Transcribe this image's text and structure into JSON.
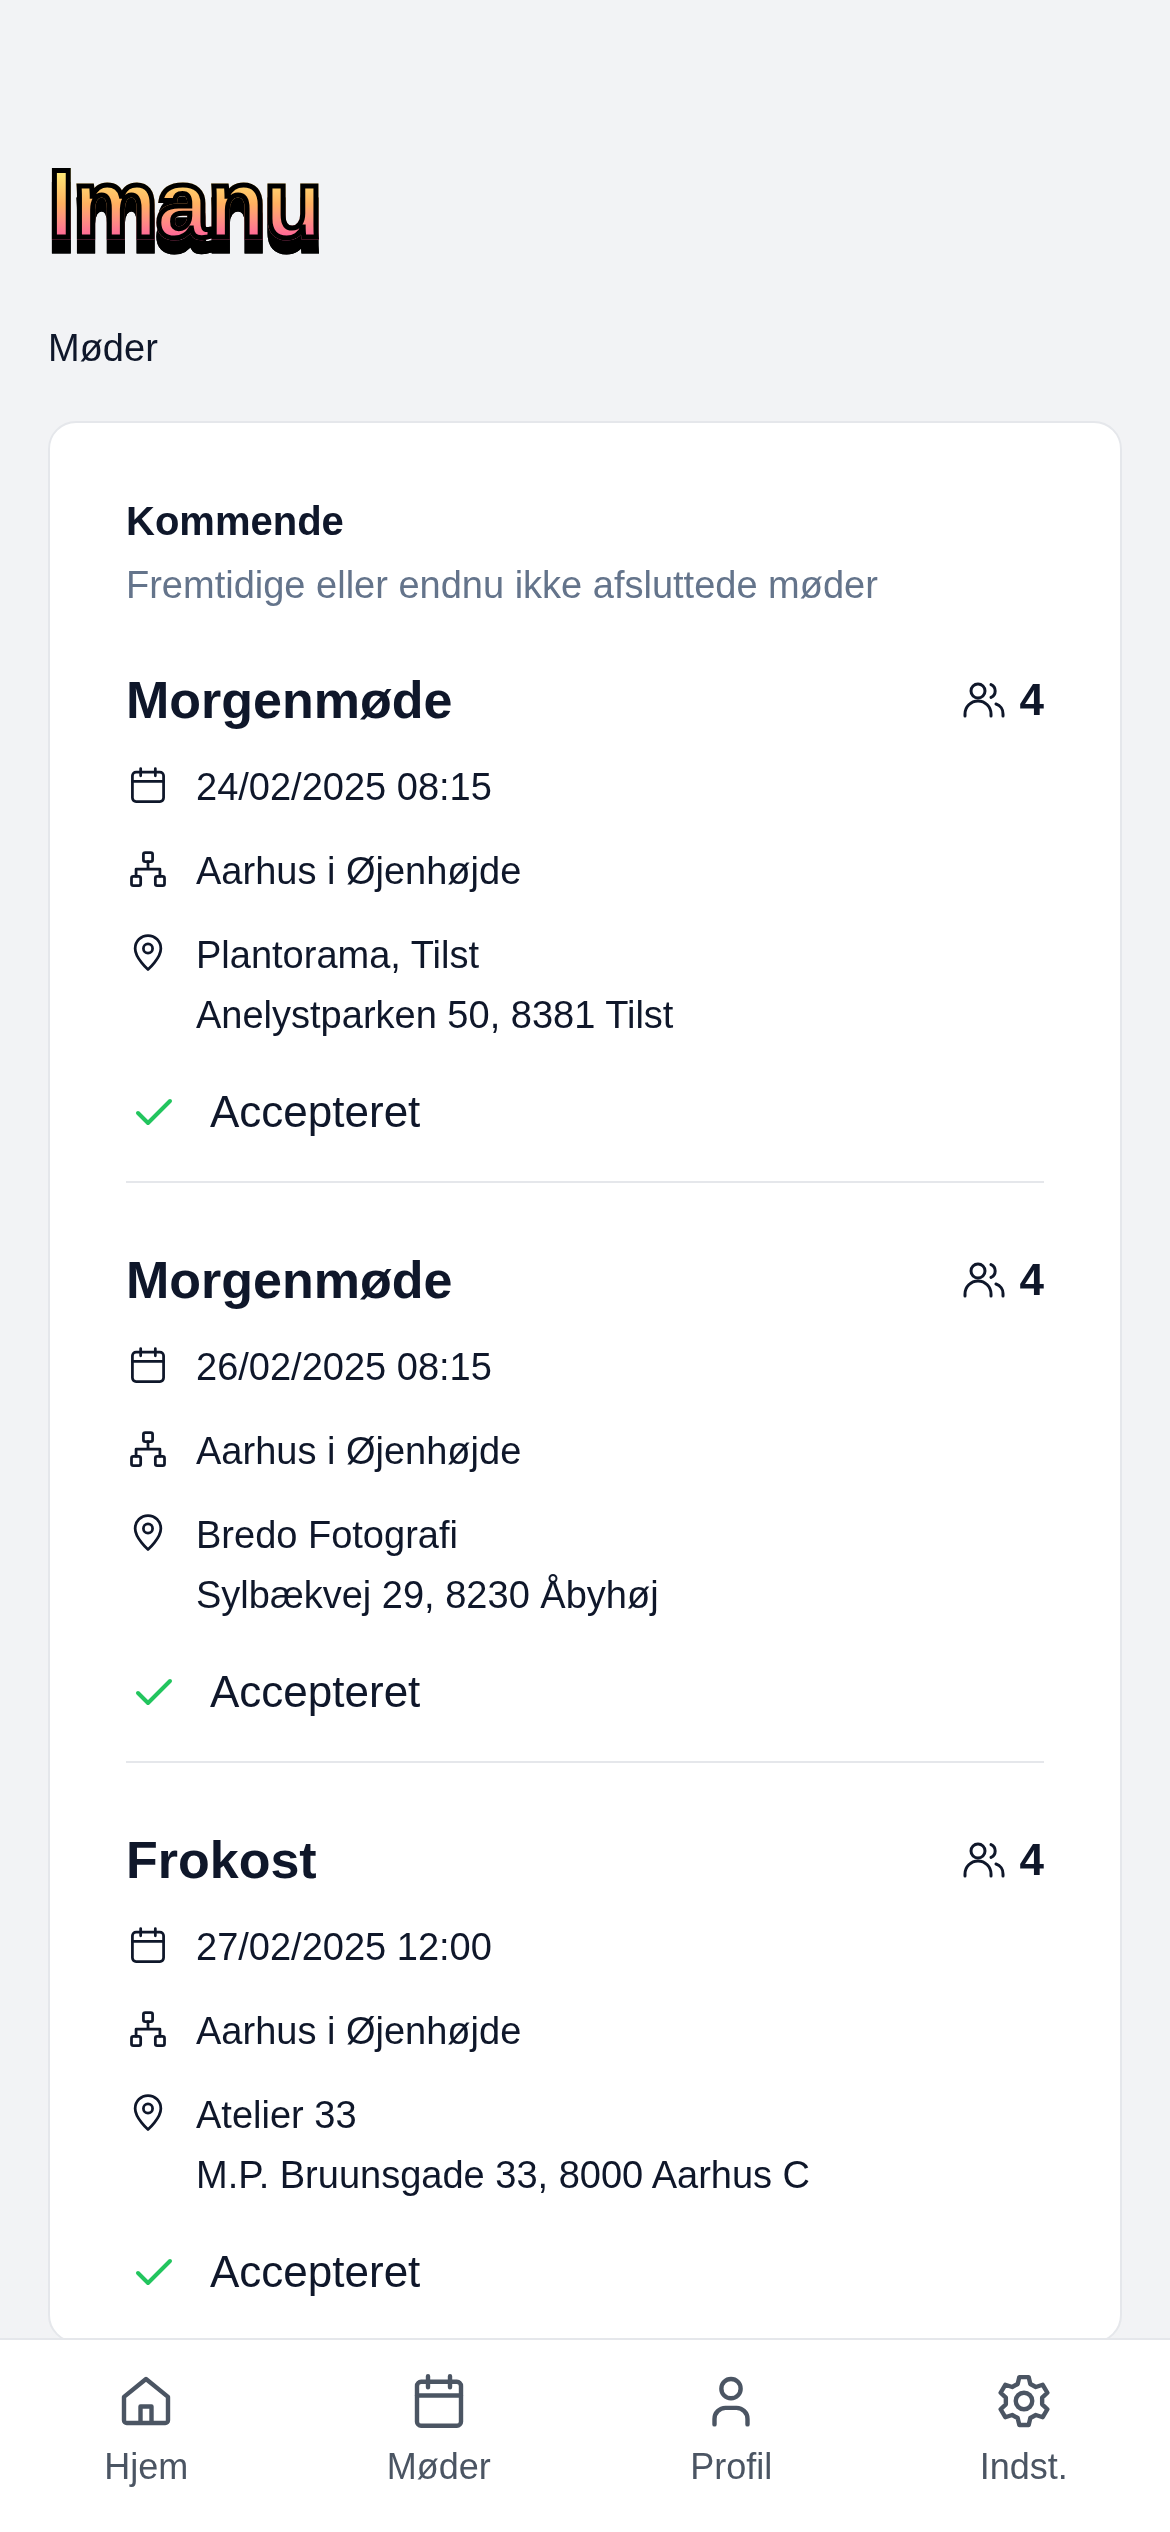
{
  "app": {
    "logo": "Imanu",
    "page_title": "Møder"
  },
  "section": {
    "title": "Kommende",
    "subtitle": "Fremtidige eller endnu ikke afsluttede møder"
  },
  "meetings": [
    {
      "title": "Morgenmøde",
      "participants": "4",
      "date": "24/02/2025 08:15",
      "group": "Aarhus i Øjenhøjde",
      "location": [
        "Plantorama, Tilst",
        "Anelystparken 50, 8381 Tilst"
      ],
      "status": "Accepteret",
      "accepted": true
    },
    {
      "title": "Morgenmøde",
      "participants": "4",
      "date": "26/02/2025 08:15",
      "group": "Aarhus i Øjenhøjde",
      "location": [
        "Bredo Fotografi",
        "Sylbækvej 29, 8230 Åbyhøj"
      ],
      "status": "Accepteret",
      "accepted": true
    },
    {
      "title": "Frokost",
      "participants": "4",
      "date": "27/02/2025 12:00",
      "group": "Aarhus i Øjenhøjde",
      "location": [
        "Atelier 33",
        "M.P. Bruunsgade 33, 8000 Aarhus C"
      ],
      "status": "Accepteret",
      "accepted": true
    }
  ],
  "nav": [
    {
      "label": "Hjem",
      "kind": "home"
    },
    {
      "label": "Møder",
      "kind": "calendar"
    },
    {
      "label": "Profil",
      "kind": "profile"
    },
    {
      "label": "Indst.",
      "kind": "settings"
    }
  ]
}
